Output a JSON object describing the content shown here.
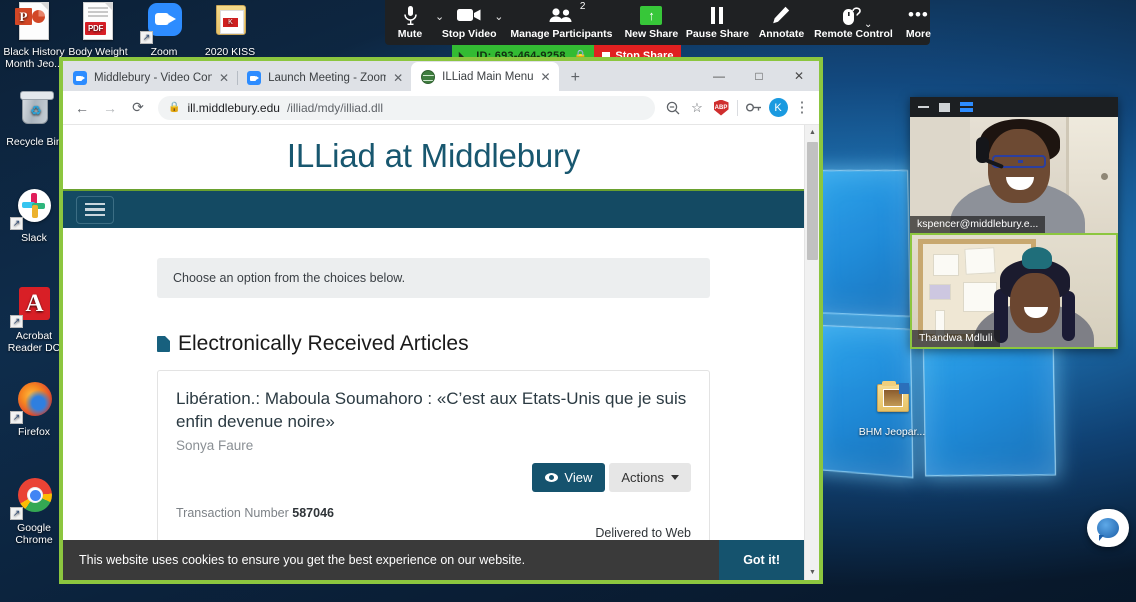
{
  "desktop": {
    "icons": [
      {
        "name": "black-history-month-jeopardy",
        "label": "Black History Month Jeo...",
        "type": "powerpoint"
      },
      {
        "name": "body-weight",
        "label": "Body Weight",
        "type": "pdf"
      },
      {
        "name": "zoom",
        "label": "Zoom",
        "type": "zoom-app"
      },
      {
        "name": "2020-kiss",
        "label": "2020 KISS",
        "type": "folder"
      },
      {
        "name": "recycle-bin",
        "label": "Recycle Bin",
        "type": "recycle"
      },
      {
        "name": "slack",
        "label": "Slack",
        "type": "slack"
      },
      {
        "name": "acrobat-reader-dc",
        "label": "Acrobat Reader DC",
        "type": "acrobat"
      },
      {
        "name": "firefox",
        "label": "Firefox",
        "type": "firefox"
      },
      {
        "name": "google-chrome",
        "label": "Google Chrome",
        "type": "chrome"
      },
      {
        "name": "bhm-jeopardy",
        "label": "BHM Jeopar...",
        "type": "folder-image"
      }
    ]
  },
  "zoom_toolbar": {
    "mute_label": "Mute",
    "stop_video_label": "Stop Video",
    "manage_participants_label": "Manage Participants",
    "participants_count": "2",
    "new_share_label": "New Share",
    "pause_share_label": "Pause Share",
    "annotate_label": "Annotate",
    "remote_control_label": "Remote Control",
    "more_label": "More"
  },
  "share_bar": {
    "meeting_id": "ID: 693-464-9258",
    "stop_share_label": "Stop Share"
  },
  "browser": {
    "tabs": [
      {
        "title": "Middlebury - Video Confer",
        "favicon": "zoom-favicon",
        "active": false
      },
      {
        "title": "Launch Meeting - Zoom",
        "favicon": "zoom-favicon",
        "active": false
      },
      {
        "title": "ILLiad Main Menu",
        "favicon": "globe-favicon",
        "active": true
      }
    ],
    "new_tab_label": "+",
    "window_controls": {
      "minimize": "—",
      "maximize": "□",
      "close": "✕"
    },
    "url_host": "ill.middlebury.edu",
    "url_path": "/illiad/mdy/illiad.dll",
    "back_label": "←",
    "forward_label": "→",
    "reload_label": "⟳",
    "zoom_out_icon": "magnifier-minus-icon",
    "bookmark_icon": "star-icon",
    "extension_icon": "adblock-shield-icon",
    "password_icon": "key-icon",
    "profile_initial": "K",
    "menu_icon": "three-dot-menu-icon"
  },
  "page": {
    "site_title": "ILLiad at Middlebury",
    "menu_button": "hamburger-menu",
    "alert_text": "Choose an option from the choices below.",
    "section_heading": "Electronically Received Articles",
    "article": {
      "title": "Libération.: Maboula Soumahoro : «C’est aux Etats-Unis que je suis enfin devenue noire»",
      "author": "Sonya Faure",
      "view_button": "View",
      "actions_button": "Actions",
      "transaction_label": "Transaction Number",
      "transaction_number": "587046",
      "status": "Delivered to Web"
    },
    "cookie_text": "This website uses cookies to ensure you get the best experience on our website.",
    "cookie_button": "Got it!"
  },
  "video_panel": {
    "minimize_icon": "minimize-icon",
    "maximize_icon": "maximize-icon",
    "view_icon": "gallery-view-icon",
    "participants": [
      {
        "name": "kspencer@middlebury.e...",
        "active_speaker": false
      },
      {
        "name": "Thandwa Mdluli",
        "active_speaker": true
      }
    ]
  },
  "chat_widget": {
    "icon": "chat-bubble-icon"
  },
  "colors": {
    "share_border": "#8cc63f",
    "illiad_navy": "#144a63",
    "zoom_blue": "#2d8cff",
    "stop_share_red": "#e02020",
    "share_green": "#33bb33"
  }
}
